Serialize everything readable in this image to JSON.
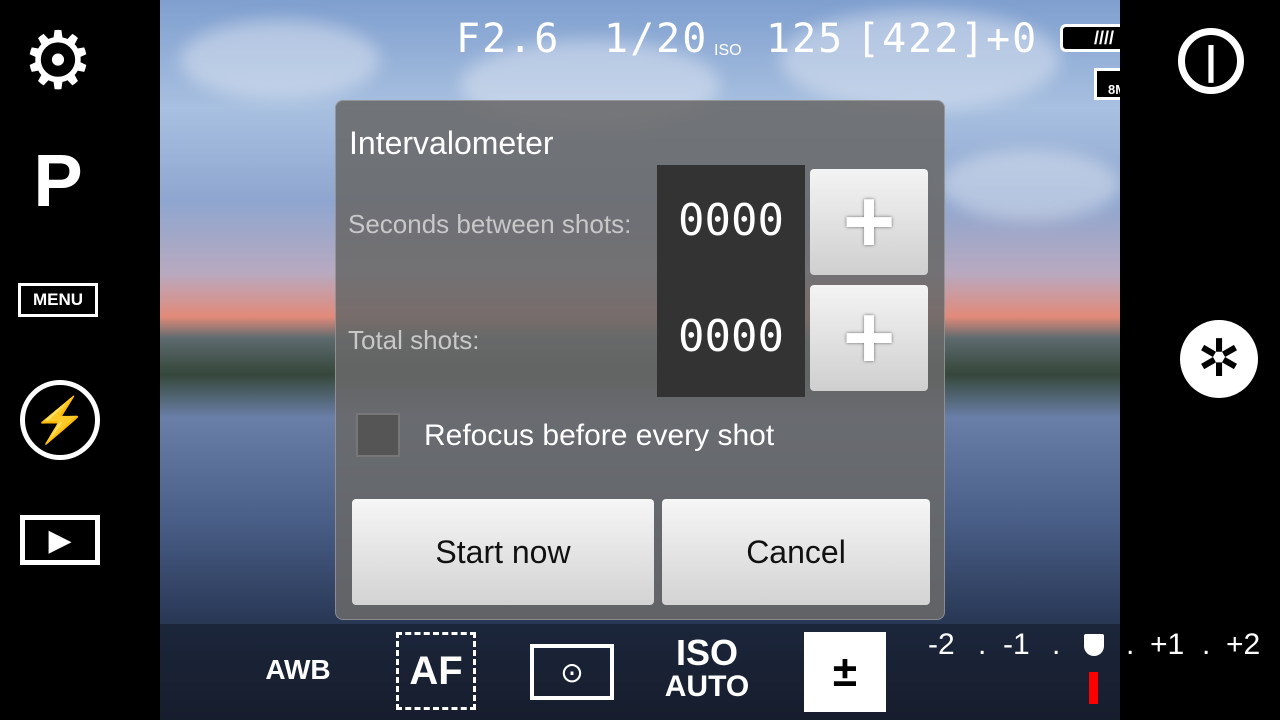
{
  "status": {
    "aperture": "F2.6",
    "shutter": "1/20",
    "iso_label": "ISO",
    "iso": "125",
    "shots_remaining": "[422]",
    "ev": "+0",
    "resolution": "8M"
  },
  "left_bar": {
    "mode": "P",
    "menu": "MENU"
  },
  "dialog": {
    "title": "Intervalometer",
    "seconds_label": "Seconds between shots:",
    "seconds_value": "0000",
    "total_label": "Total shots:",
    "total_value": "0000",
    "refocus_label": "Refocus before every shot",
    "refocus_checked": false,
    "start": "Start now",
    "cancel": "Cancel"
  },
  "bottom": {
    "awb": "AWB",
    "af": "AF",
    "iso": "ISO",
    "iso_mode": "AUTO",
    "ev_scale": [
      "-2",
      ".",
      "-1",
      ".",
      ".",
      "+1",
      ".",
      "+2"
    ],
    "ev_value": 0
  },
  "colors": {
    "ev_indicator": "#ff0000"
  }
}
